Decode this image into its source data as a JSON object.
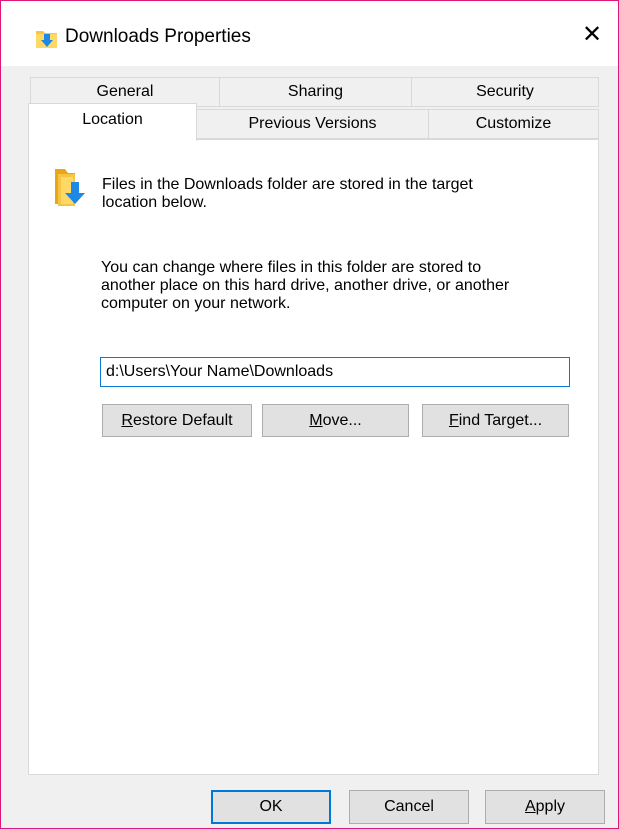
{
  "window": {
    "title": "Downloads Properties",
    "close_glyph": "✕",
    "title_icon": "downloads-folder-icon"
  },
  "tabs": {
    "row1": [
      "General",
      "Sharing",
      "Security"
    ],
    "row2": [
      "Location",
      "Previous Versions",
      "Customize"
    ],
    "selected": "Location"
  },
  "location": {
    "info_line1": "Files in the Downloads folder are stored in the target",
    "info_line2": "location below.",
    "desc_line1": "You can change where files in this folder are stored to",
    "desc_line2": "another place on this hard drive, another drive, or another",
    "desc_line3": "computer on your network.",
    "path_value": "d:\\Users\\Your Name\\Downloads",
    "restore_underlined": "R",
    "restore_rest": "estore Default",
    "move_underlined": "M",
    "move_rest": "ove...",
    "find_underlined": "F",
    "find_rest": "ind Target..."
  },
  "footer": {
    "ok": "OK",
    "cancel": "Cancel",
    "apply_underlined": "A",
    "apply_rest": "pply"
  },
  "colors": {
    "accent": "#0078d7",
    "window_border": "#e0177a",
    "folder_yellow": "#f6c342",
    "arrow_blue": "#1e88e5"
  }
}
